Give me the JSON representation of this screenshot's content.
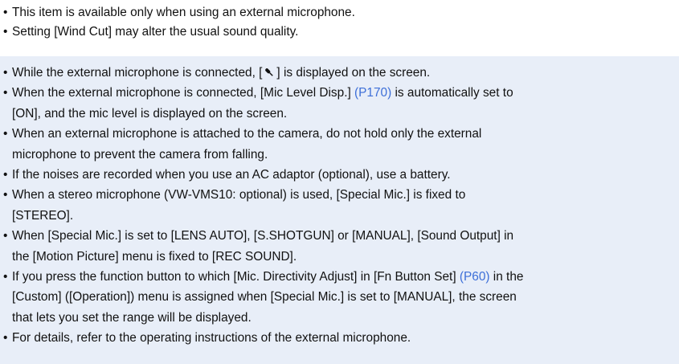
{
  "notes": [
    "This item is available only when using an external microphone.",
    "Setting [Wind Cut] may alter the usual sound quality."
  ],
  "box": {
    "item1_before": "While the external microphone is connected, [",
    "item1_after": "] is displayed on the screen.",
    "item1_icon": "microphone-icon",
    "item2_before": "When the external microphone is connected, [Mic Level Disp.] ",
    "item2_link": "(P170)",
    "item2_after": " is automatically set to",
    "item2_cont": "[ON], and the mic level is displayed on the screen.",
    "item3_line1": "When an external microphone is attached to the camera, do not hold only the external",
    "item3_line2": "microphone to prevent the camera from falling.",
    "item4": "If the noises are recorded when you use an AC adaptor (optional), use a battery.",
    "item5_line1": "When a stereo microphone (VW-VMS10: optional) is used, [Special Mic.] is fixed to",
    "item5_line2": "[STEREO].",
    "item6_line1": "When [Special Mic.] is set to [LENS AUTO], [S.SHOTGUN] or [MANUAL], [Sound Output] in",
    "item6_line2": "the [Motion Picture] menu is fixed to [REC SOUND].",
    "item7_before": "If you press the function button to which [Mic. Directivity Adjust] in [Fn Button Set] ",
    "item7_link": "(P60)",
    "item7_after": " in the",
    "item7_line2": "[Custom] ([Operation]) menu is assigned when [Special Mic.] is set to [MANUAL], the screen",
    "item7_line3": "that lets you set the range will be displayed.",
    "item8": "For details, refer to the operating instructions of the external microphone."
  },
  "colors": {
    "box_background": "#e8eef8",
    "link": "#3d6fd8"
  }
}
